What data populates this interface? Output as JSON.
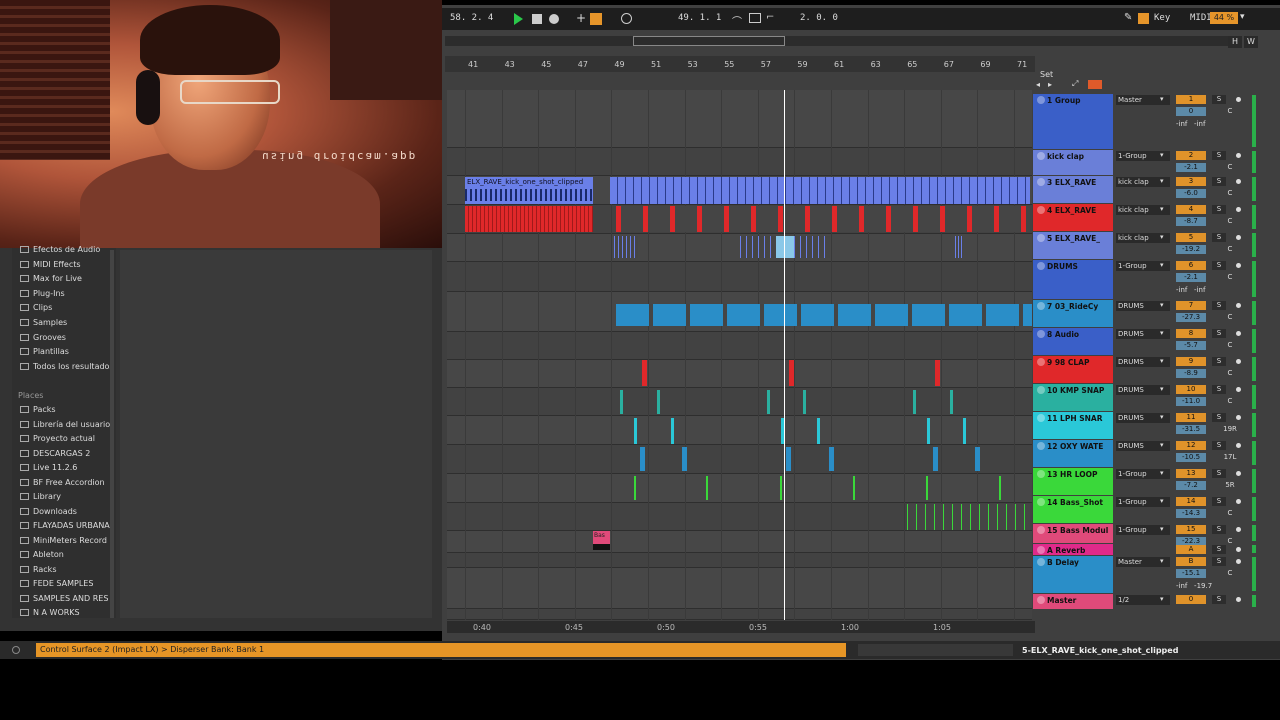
{
  "overlay": {
    "watermark": "using droidcam.app"
  },
  "transport": {
    "position": "58.  2.  4",
    "loop_start": "49.  1.  1",
    "loop_length": "2.  0.  0",
    "key_label": "Key",
    "midi_label": "MIDI",
    "cpu_label": "44 %"
  },
  "overview": {
    "h_label": "H",
    "w_label": "W"
  },
  "ruler": {
    "bars": [
      "41",
      "43",
      "45",
      "47",
      "49",
      "51",
      "53",
      "55",
      "57",
      "59",
      "61",
      "63",
      "65",
      "67",
      "69",
      "71"
    ]
  },
  "time_ruler": [
    "0:40",
    "0:45",
    "0:50",
    "0:55",
    "1:00",
    "1:05"
  ],
  "set_label": "Set",
  "clip_labels": {
    "kick_clip": "ELX_RAVE_kick_one_shot_clipped",
    "bass_clip": "Bas"
  },
  "tracks": [
    {
      "name": "1 Group",
      "route": "Master",
      "num": "1",
      "vol": "0",
      "pan": "C",
      "extra": "-inf   -inf",
      "color": "#3a5fc8"
    },
    {
      "name": "kick clap",
      "route": "1-Group",
      "num": "2",
      "vol": "-2.1",
      "pan": "C",
      "color": "#6a7fd8"
    },
    {
      "name": "3 ELX_RAVE",
      "route": "kick clap",
      "num": "3",
      "vol": "-6.0",
      "pan": "C",
      "color": "#6a7fd8"
    },
    {
      "name": "4 ELX_RAVE",
      "route": "kick clap",
      "num": "4",
      "vol": "-8.7",
      "pan": "C",
      "color": "#e0282a"
    },
    {
      "name": "5 ELX_RAVE_",
      "route": "kick clap",
      "num": "5",
      "vol": "-19.2",
      "pan": "C",
      "color": "#6a7fd8"
    },
    {
      "name": "DRUMS",
      "route": "1-Group",
      "num": "6",
      "vol": "-2.1",
      "pan": "C",
      "extra": "-inf   -inf",
      "color": "#3a5fc8"
    },
    {
      "name": "7 03_RideCy",
      "route": "DRUMS",
      "num": "7",
      "vol": "-27.3",
      "pan": "C",
      "color": "#2a8ec8"
    },
    {
      "name": "8 Audio",
      "route": "DRUMS",
      "num": "8",
      "vol": "-5.7",
      "pan": "C",
      "color": "#3a5fc8"
    },
    {
      "name": "9 98 CLAP",
      "route": "DRUMS",
      "num": "9",
      "vol": "-8.9",
      "pan": "C",
      "color": "#e0282a"
    },
    {
      "name": "10 KMP SNAP",
      "route": "DRUMS",
      "num": "10",
      "vol": "-11.0",
      "pan": "C",
      "color": "#2ab0a0"
    },
    {
      "name": "11 LPH SNAR",
      "route": "DRUMS",
      "num": "11",
      "vol": "-31.5",
      "pan": "19R",
      "color": "#2ac8d8"
    },
    {
      "name": "12 OXY WATE",
      "route": "DRUMS",
      "num": "12",
      "vol": "-10.5",
      "pan": "17L",
      "color": "#2a8ec8"
    },
    {
      "name": "13 HR LOOP",
      "route": "1-Group",
      "num": "13",
      "vol": "-7.2",
      "pan": "5R",
      "color": "#3ad83a"
    },
    {
      "name": "14 Bass_Shot",
      "route": "1-Group",
      "num": "14",
      "vol": "-14.3",
      "pan": "C",
      "color": "#3ad83a"
    },
    {
      "name": "15 Bass Modul",
      "route": "1-Group",
      "num": "15",
      "vol": "-22.3",
      "pan": "C",
      "color": "#e04a7a"
    },
    {
      "name": "A Reverb",
      "route": "",
      "num": "A",
      "vol": "",
      "pan": "Post",
      "color": "#e02a8a"
    },
    {
      "name": "B Delay",
      "route": "Master",
      "num": "B",
      "vol": "-15.1",
      "pan": "C",
      "extra": "-inf   -19.7",
      "color": "#2a8ec8"
    },
    {
      "name": "Master",
      "route": "1/2",
      "num": "0",
      "vol": "0",
      "pan": "",
      "color": "#e04a7a"
    }
  ],
  "browser": {
    "categories": [
      "Efectos de Audio",
      "MIDI Effects",
      "Max for Live",
      "Plug-Ins",
      "Clips",
      "Samples",
      "Grooves",
      "Plantillas",
      "Todos los resultados"
    ],
    "places_label": "Places",
    "places": [
      "Packs",
      "Librería del usuario",
      "Proyecto actual",
      "DESCARGAS 2",
      "Live 11.2.6",
      "BF Free Accordion",
      "Library",
      "Downloads",
      "FLAYADAS URBANA",
      "MiniMeters Record",
      "Ableton",
      "Racks",
      "FEDE SAMPLES",
      "SAMPLES AND RES",
      "N A WORKS"
    ]
  },
  "status": {
    "message": "Control Surface 2 (Impact LX) > Disperser Bank: Bank 1",
    "selected_clip": "5-ELX_RAVE_kick_one_shot_clipped"
  }
}
